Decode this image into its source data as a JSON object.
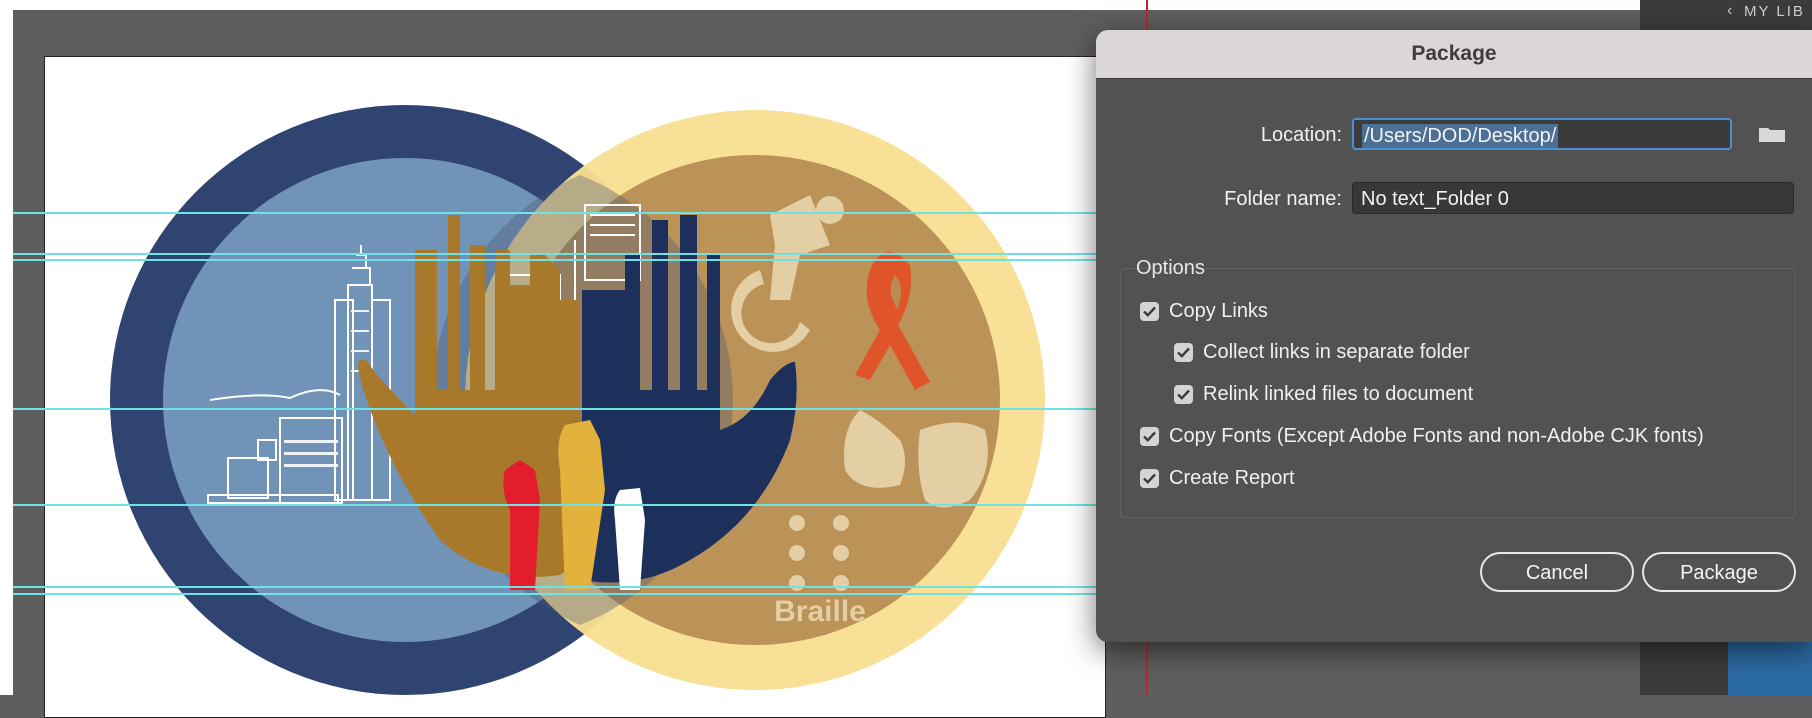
{
  "canvas": {
    "art_text": "Braille",
    "palette": {
      "navy": "#2f4470",
      "light_blue": "#7193b7",
      "yellow": "#f8df93",
      "gold": "#b78d53",
      "hand_gold": "#a8792a",
      "hand_navy": "#1d2f5b",
      "red": "#e41d2c",
      "mustard": "#e3b23c",
      "ribbon": "#e0542a",
      "guide": "#6fe3e3"
    }
  },
  "library_panel": {
    "label": "MY LIB",
    "chevron_icon": "chevron-left-icon"
  },
  "dialog": {
    "title": "Package",
    "location": {
      "label": "Location:",
      "value": "/Users/DOD/Desktop/",
      "browse_icon": "folder-icon"
    },
    "folder_name": {
      "label": "Folder name:",
      "value": "No text_Folder 0"
    },
    "options": {
      "title": "Options",
      "items": [
        {
          "label": "Copy Links",
          "checked": true
        },
        {
          "label": "Collect links in separate folder",
          "checked": true
        },
        {
          "label": "Relink linked files to document",
          "checked": true
        },
        {
          "label": "Copy Fonts (Except Adobe Fonts and non-Adobe CJK fonts)",
          "checked": true
        },
        {
          "label": "Create Report",
          "checked": true
        }
      ]
    },
    "buttons": {
      "cancel": "Cancel",
      "package": "Package"
    }
  }
}
